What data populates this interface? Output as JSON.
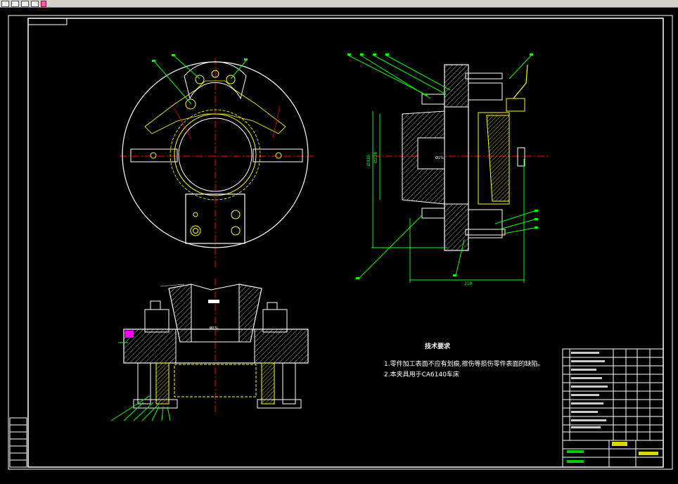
{
  "window": {
    "toolbar_icons": [
      "new-icon",
      "open-icon",
      "save-icon",
      "print-icon",
      "undo-icon"
    ]
  },
  "drawing": {
    "colors": {
      "background": "#000000",
      "outline": "#ffffff",
      "centerline": "#ff0000",
      "part": "#ffff00",
      "leader": "#00ff00",
      "magenta": "#ff00ff",
      "hatch": "#cccccc"
    },
    "tech_requirements": {
      "title": "技术要求",
      "items": [
        "1.零件加工表面不应有划痕,擦伤等损伤零件表面的缺陷。",
        "2.本夹具用于CA6140车床"
      ]
    },
    "dimensions": {
      "overall_height": "Ø330",
      "bore": "Ø220",
      "width": "210",
      "section_dia": "Ø1%",
      "bore_small": "Ø1%"
    }
  }
}
